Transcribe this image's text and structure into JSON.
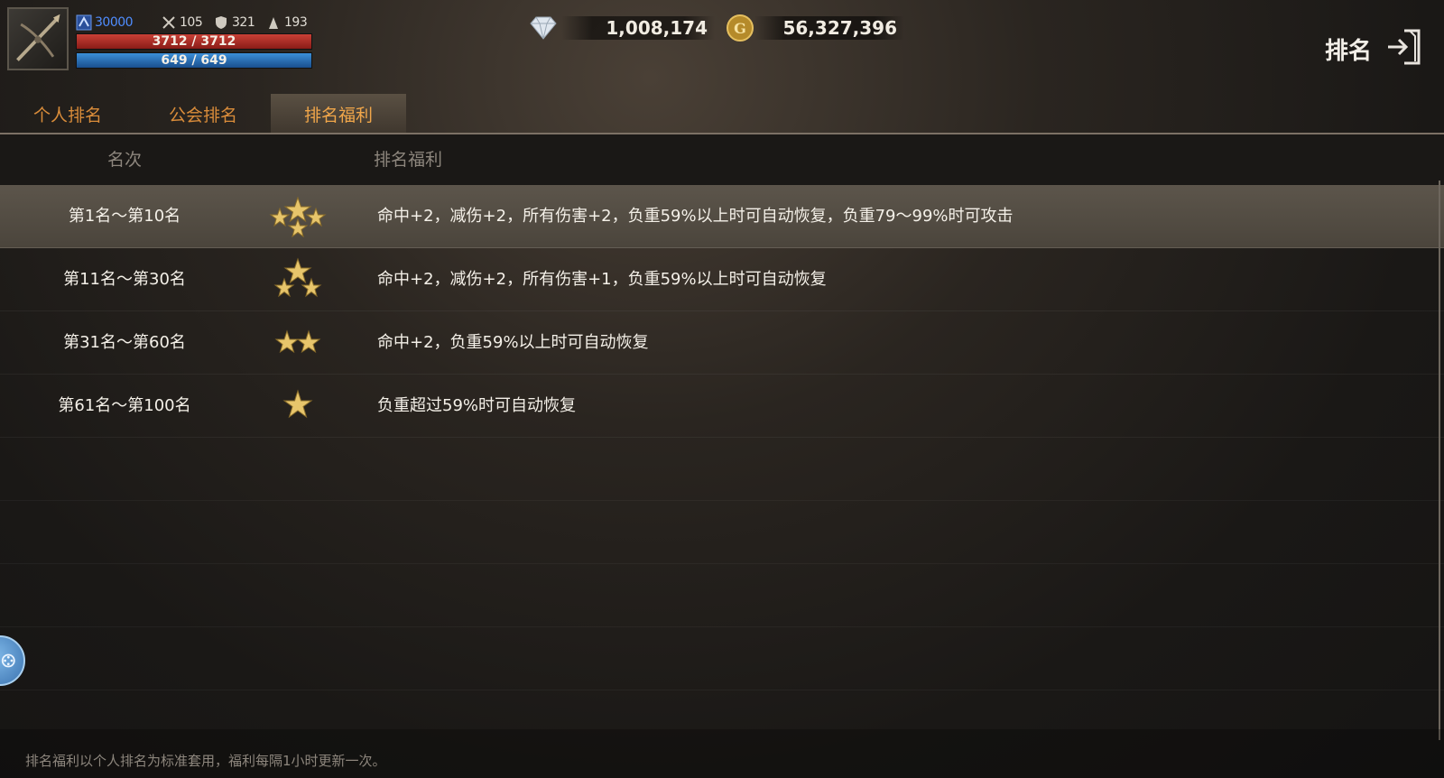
{
  "player": {
    "level": "30000",
    "attack": "105",
    "defense": "321",
    "weight": "193",
    "hp": "3712 / 3712",
    "mp": "649 / 649"
  },
  "currency": {
    "diamonds": "1,008,174",
    "gold": "56,327,396"
  },
  "page": {
    "title": "排名"
  },
  "tabs": [
    {
      "label": "个人排名",
      "active": false
    },
    {
      "label": "公会排名",
      "active": false
    },
    {
      "label": "排名福利",
      "active": true
    }
  ],
  "table": {
    "headers": {
      "rank": "名次",
      "benefit": "排名福利"
    },
    "rows": [
      {
        "rank": "第1名～第10名",
        "stars": 4,
        "benefit": "命中+2，减伤+2，所有伤害+2，负重59%以上时可自动恢复，负重79～99%时可攻击"
      },
      {
        "rank": "第11名～第30名",
        "stars": 3,
        "benefit": "命中+2，减伤+2，所有伤害+1，负重59%以上时可自动恢复"
      },
      {
        "rank": "第31名～第60名",
        "stars": 2,
        "benefit": "命中+2，负重59%以上时可自动恢复"
      },
      {
        "rank": "第61名～第100名",
        "stars": 1,
        "benefit": "负重超过59%时可自动恢复"
      }
    ]
  },
  "footer": {
    "note": "排名福利以个人排名为标准套用，福利每隔1小时更新一次。"
  },
  "colors": {
    "tab_text": "#d98c3a",
    "star_gold": "#e7c56b",
    "hp_bar": "#c94036",
    "mp_bar": "#3b8fd8",
    "level_text": "#4f8dff"
  }
}
